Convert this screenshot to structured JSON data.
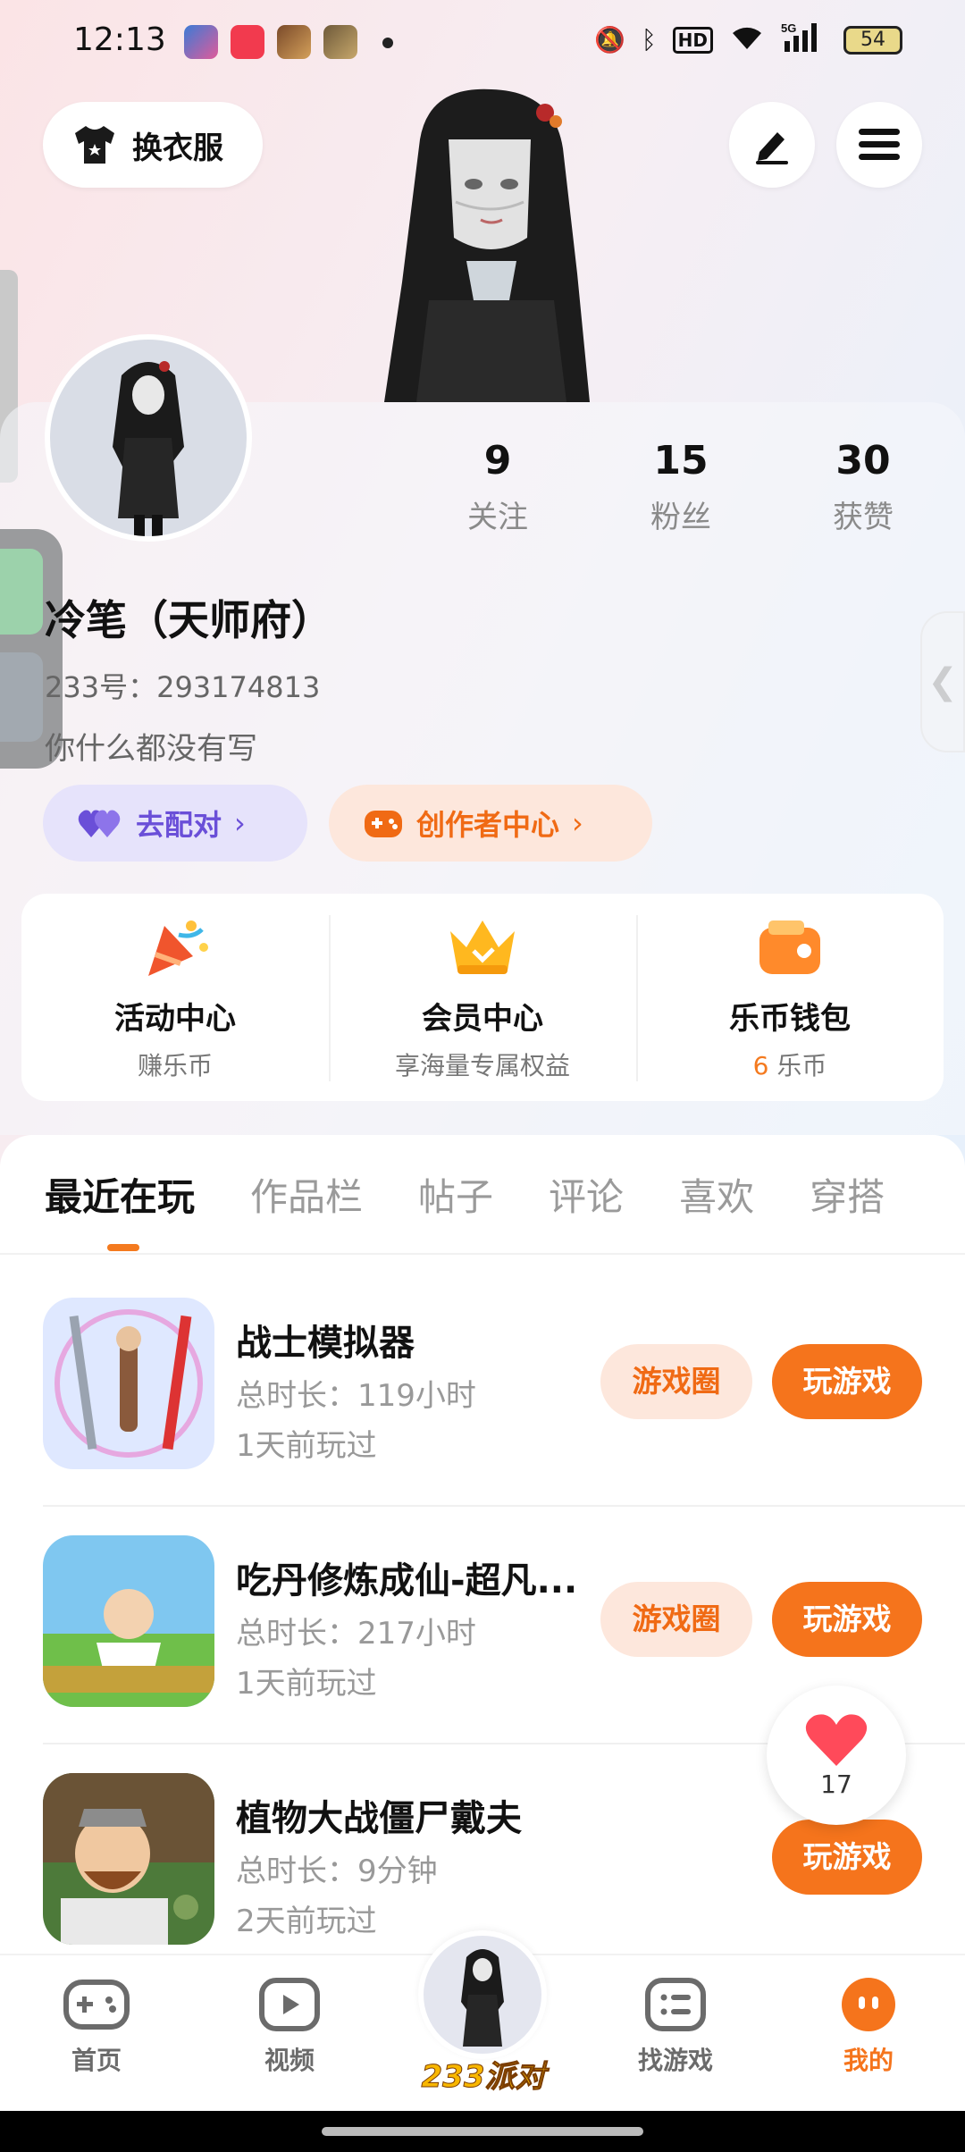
{
  "status_bar": {
    "time": "12:13",
    "battery": "54",
    "network": "5G"
  },
  "header": {
    "outfit_label": "换衣服"
  },
  "profile": {
    "name": "冷笔（天师府）",
    "id_line": "233号：293174813",
    "bio": "你什么都没有写",
    "stats": [
      {
        "value": "9",
        "label": "关注"
      },
      {
        "value": "15",
        "label": "粉丝"
      },
      {
        "value": "30",
        "label": "获赞"
      }
    ],
    "pair_label": "去配对",
    "creator_label": "创作者中心"
  },
  "services": [
    {
      "title": "活动中心",
      "sub": "赚乐币",
      "icon": "party-popper-icon"
    },
    {
      "title": "会员中心",
      "sub": "享海量专属权益",
      "icon": "crown-icon"
    },
    {
      "title": "乐币钱包",
      "sub_num": "6",
      "sub_unit": "乐币",
      "icon": "wallet-icon"
    }
  ],
  "tabs": [
    "最近在玩",
    "作品栏",
    "帖子",
    "评论",
    "喜欢",
    "穿搭"
  ],
  "games": [
    {
      "name": "战士模拟器",
      "duration": "总时长：119小时",
      "last_played": "1天前玩过",
      "circle_label": "游戏圈",
      "play_label": "玩游戏"
    },
    {
      "name": "吃丹修炼成仙-超凡...",
      "duration": "总时长：217小时",
      "last_played": "1天前玩过",
      "circle_label": "游戏圈",
      "play_label": "玩游戏"
    },
    {
      "name": "植物大战僵尸戴夫",
      "duration": "总时长：9分钟",
      "last_played": "2天前玩过",
      "play_label": "玩游戏"
    }
  ],
  "like_count": "17",
  "bottom_nav": [
    {
      "label": "首页",
      "icon": "gamepad-icon"
    },
    {
      "label": "视频",
      "icon": "video-play-icon"
    },
    {
      "label": "233派对",
      "icon": "avatar-party-icon"
    },
    {
      "label": "找游戏",
      "icon": "list-icon"
    },
    {
      "label": "我的",
      "icon": "profile-face-icon"
    }
  ],
  "colors": {
    "accent": "#f5741c",
    "pair": "#6a4fd8"
  }
}
